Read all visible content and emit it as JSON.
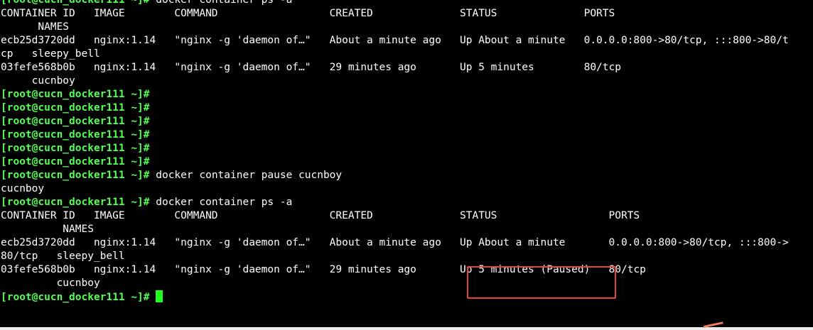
{
  "terminal": {
    "cursor_color": "#1dff1d",
    "prompt_color": "#54ff54",
    "lines": [
      {
        "kind": "prompt",
        "prompt": "[root@cucn_docker111 ~]#",
        "command": " docker container ps -a"
      },
      {
        "kind": "output",
        "text": "CONTAINER ID   IMAGE        COMMAND                  CREATED              STATUS              PORTS"
      },
      {
        "kind": "output",
        "text": "      NAMES"
      },
      {
        "kind": "output",
        "text": "ecb25d3720dd   nginx:1.14   \"nginx -g 'daemon of…\"   About a minute ago   Up About a minute   0.0.0.0:800->80/tcp, :::800->80/t"
      },
      {
        "kind": "output",
        "text": "cp   sleepy_bell"
      },
      {
        "kind": "output",
        "text": "03fefe568b0b   nginx:1.14   \"nginx -g 'daemon of…\"   29 minutes ago       Up 5 minutes        80/tcp"
      },
      {
        "kind": "output",
        "text": "     cucnboy"
      },
      {
        "kind": "prompt",
        "prompt": "[root@cucn_docker111 ~]#",
        "command": ""
      },
      {
        "kind": "prompt",
        "prompt": "[root@cucn_docker111 ~]#",
        "command": ""
      },
      {
        "kind": "prompt",
        "prompt": "[root@cucn_docker111 ~]#",
        "command": ""
      },
      {
        "kind": "prompt",
        "prompt": "[root@cucn_docker111 ~]#",
        "command": ""
      },
      {
        "kind": "prompt",
        "prompt": "[root@cucn_docker111 ~]#",
        "command": ""
      },
      {
        "kind": "prompt",
        "prompt": "[root@cucn_docker111 ~]#",
        "command": ""
      },
      {
        "kind": "prompt",
        "prompt": "[root@cucn_docker111 ~]#",
        "command": " docker container pause cucnboy"
      },
      {
        "kind": "output",
        "text": "cucnboy"
      },
      {
        "kind": "prompt",
        "prompt": "[root@cucn_docker111 ~]#",
        "command": " docker container ps -a"
      },
      {
        "kind": "output",
        "text": "CONTAINER ID   IMAGE        COMMAND                  CREATED              STATUS                  PORTS"
      },
      {
        "kind": "output",
        "text": "          NAMES"
      },
      {
        "kind": "output",
        "text": "ecb25d3720dd   nginx:1.14   \"nginx -g 'daemon of…\"   About a minute ago   Up About a minute       0.0.0.0:800->80/tcp, :::800->"
      },
      {
        "kind": "output",
        "text": "80/tcp   sleepy_bell"
      },
      {
        "kind": "output",
        "text": "03fefe568b0b   nginx:1.14   \"nginx -g 'daemon of…\"   29 minutes ago       Up 5 minutes (Paused)   80/tcp"
      },
      {
        "kind": "output",
        "text": "         cucnboy"
      },
      {
        "kind": "cursor",
        "prompt": "[root@cucn_docker111 ~]#",
        "command": " "
      }
    ]
  },
  "annotation": {
    "highlighted_text": "Up 5 minutes (Paused)",
    "box_color": "#e8413a"
  }
}
